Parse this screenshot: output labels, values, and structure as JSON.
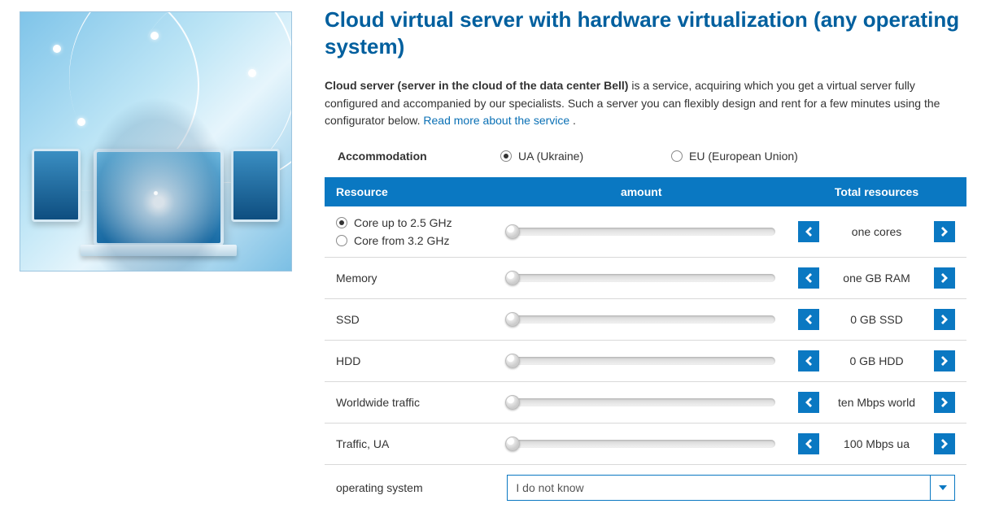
{
  "title": "Cloud virtual server with hardware virtualization (any operating system)",
  "lead": {
    "bold": "Cloud server (server in the cloud of the data center Bell)",
    "rest": " is a service, acquiring which you get a virtual server fully configured and accompanied by our specialists. Such a server you can flexibly design and rent for a few minutes using the configurator below. ",
    "link": "Read more about the service",
    "tail": " ."
  },
  "accommodation": {
    "label": "Accommodation",
    "options": [
      {
        "label": "UA (Ukraine)",
        "checked": true
      },
      {
        "label": "EU (European Union)",
        "checked": false
      }
    ]
  },
  "headers": {
    "resource": "Resource",
    "amount": "amount",
    "total": "Total resources"
  },
  "rows": {
    "core": {
      "opt1": "Core up to 2.5 GHz",
      "opt2": "Core from 3.2 GHz",
      "value": "one",
      "unit": "cores"
    },
    "memory": {
      "label": "Memory",
      "value": "one",
      "unit": "GB RAM"
    },
    "ssd": {
      "label": "SSD",
      "value": "0",
      "unit": "GB SSD"
    },
    "hdd": {
      "label": "HDD",
      "value": "0",
      "unit": "GB HDD"
    },
    "world": {
      "label": "Worldwide traffic",
      "value": "ten",
      "unit": "Mbps world"
    },
    "ua": {
      "label": "Traffic, UA",
      "value": "100",
      "unit": "Mbps ua"
    },
    "os": {
      "label": "operating system",
      "selected": "I do not know"
    }
  }
}
